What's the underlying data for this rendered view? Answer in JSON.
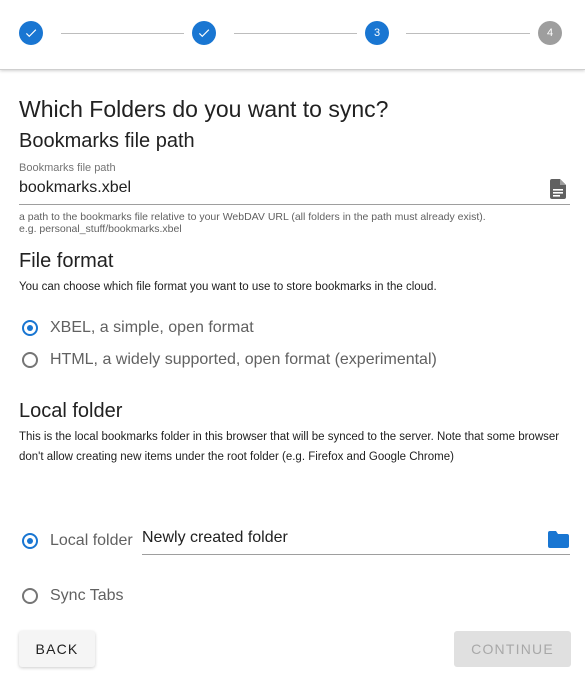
{
  "stepper": {
    "steps": [
      {
        "label": "✓",
        "state": "done"
      },
      {
        "label": "✓",
        "state": "done"
      },
      {
        "label": "3",
        "state": "active"
      },
      {
        "label": "4",
        "state": "inactive"
      }
    ]
  },
  "page": {
    "title": "Which Folders do you want to sync?"
  },
  "bookmarks_path": {
    "heading": "Bookmarks file path",
    "field_label": "Bookmarks file path",
    "value": "bookmarks.xbel",
    "hint_line1": "a path to the bookmarks file relative to your WebDAV URL (all folders in the path must already exist).",
    "hint_line2": "e.g. personal_stuff/bookmarks.xbel"
  },
  "file_format": {
    "heading": "File format",
    "description": "You can choose which file format you want to use to store bookmarks in the cloud.",
    "options": [
      {
        "label": "XBEL, a simple, open format",
        "checked": true
      },
      {
        "label": "HTML, a widely supported, open format (experimental)",
        "checked": false
      }
    ]
  },
  "local_folder": {
    "heading": "Local folder",
    "description": "This is the local bookmarks folder in this browser that will be synced to the server. Note that some browser don't allow creating new items under the root folder (e.g. Firefox and Google Chrome)",
    "option_label": "Local folder",
    "option_checked": true,
    "folder_value": "Newly created folder",
    "sync_tabs_label": "Sync Tabs",
    "sync_tabs_checked": false
  },
  "buttons": {
    "back": "BACK",
    "continue": "CONTINUE"
  },
  "colors": {
    "accent": "#1976d2",
    "inactive_step": "#9e9e9e"
  },
  "icons": {
    "file": "file-document-icon",
    "folder": "folder-icon",
    "check": "check-icon"
  }
}
